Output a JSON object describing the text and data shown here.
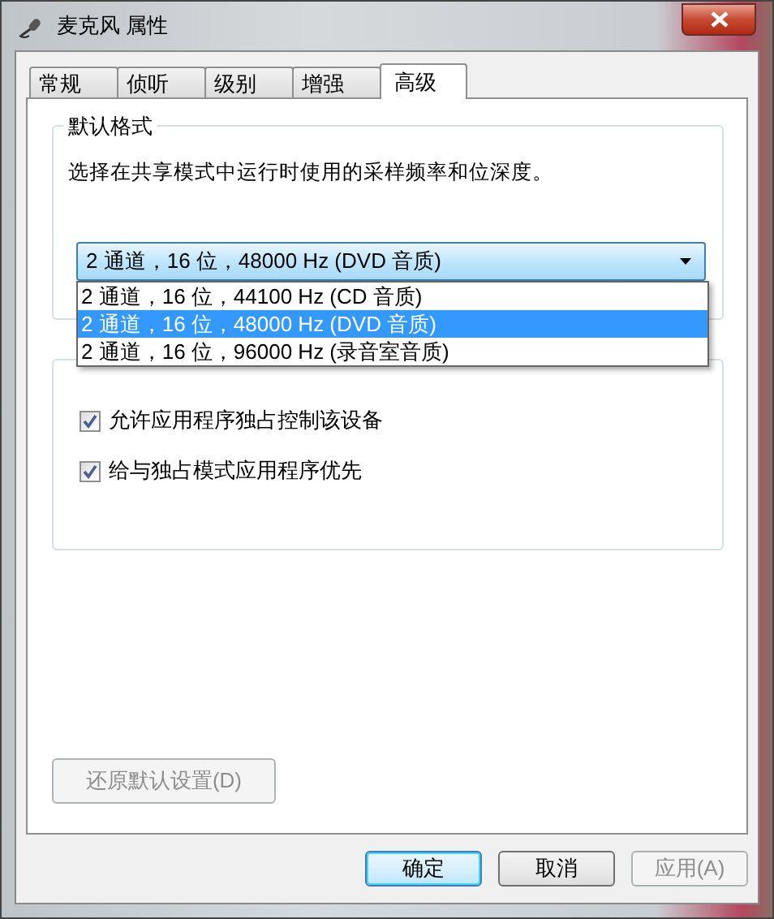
{
  "window": {
    "title": "麦克风 属性"
  },
  "tabs": [
    {
      "label": "常规",
      "selected": false
    },
    {
      "label": "侦听",
      "selected": false
    },
    {
      "label": "级别",
      "selected": false
    },
    {
      "label": "增强",
      "selected": false
    },
    {
      "label": "高级",
      "selected": true
    }
  ],
  "default_format": {
    "title": "默认格式",
    "description": "选择在共享模式中运行时使用的采样频率和位深度。",
    "dropdown": {
      "value": "2 通道，16 位，48000 Hz (DVD 音质)",
      "expanded": true,
      "options": [
        {
          "label": "2 通道，16 位，44100 Hz (CD 音质)",
          "selected": false
        },
        {
          "label": "2 通道，16 位，48000 Hz (DVD 音质)",
          "selected": true
        },
        {
          "label": "2 通道，16 位，96000 Hz (录音室音质)",
          "selected": false
        }
      ]
    }
  },
  "exclusive_mode": {
    "options": [
      {
        "label": "允许应用程序独占控制该设备",
        "checked": true
      },
      {
        "label": "给与独占模式应用程序优先",
        "checked": true
      }
    ]
  },
  "restore_button": {
    "label": "还原默认设置(D)",
    "disabled": true
  },
  "buttons": [
    {
      "label": "确定",
      "disabled": false,
      "focused": true
    },
    {
      "label": "取消",
      "disabled": false,
      "focused": false
    },
    {
      "label": "应用(A)",
      "disabled": true,
      "focused": false
    }
  ]
}
